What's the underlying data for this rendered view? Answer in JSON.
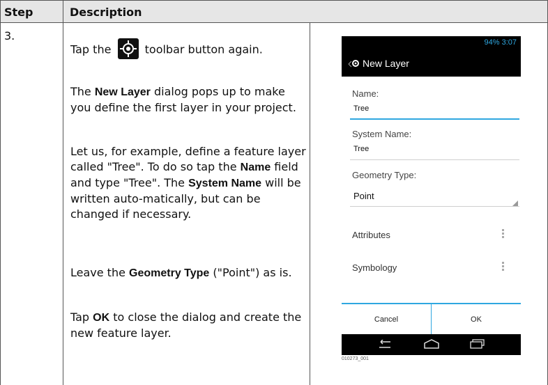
{
  "header": {
    "step": "Step",
    "description": "Description"
  },
  "row": {
    "step": "3.",
    "p1_before": "Tap the",
    "p1_after": "toolbar button again.",
    "p2_a": "The ",
    "p2_bold": "New Layer",
    "p2_b": " dialog pops up to make you define the first layer in your project.",
    "p3_a": "Let us, for example, define a feature layer called \"Tree\". To do so tap the ",
    "p3_bold1": "Name",
    "p3_b": " field and type \"Tree\". The ",
    "p3_bold2": "System Name",
    "p3_c": " will be written auto-matically, but can be changed if necessary.",
    "p4_a": "Leave the ",
    "p4_bold": "Geometry Type",
    "p4_b": " (\"Point\") as is.",
    "p5_a": "Tap ",
    "p5_bold": "OK",
    "p5_b": " to close the dialog and create the new feature layer."
  },
  "phone": {
    "status": "94%  3:07",
    "title": "New Layer",
    "name_label": "Name:",
    "name_value": "Tree",
    "system_name_label": "System Name:",
    "system_name_value": "Tree",
    "geometry_label": "Geometry Type:",
    "geometry_value": "Point",
    "attributes": "Attributes",
    "symbology": "Symbology",
    "cancel": "Cancel",
    "ok": "OK"
  },
  "caption": "010273_001",
  "icons": {
    "toolbar": "gps-target-icon",
    "gear": "gear-icon",
    "back": "back-icon",
    "home": "home-icon",
    "recents": "recents-icon"
  }
}
